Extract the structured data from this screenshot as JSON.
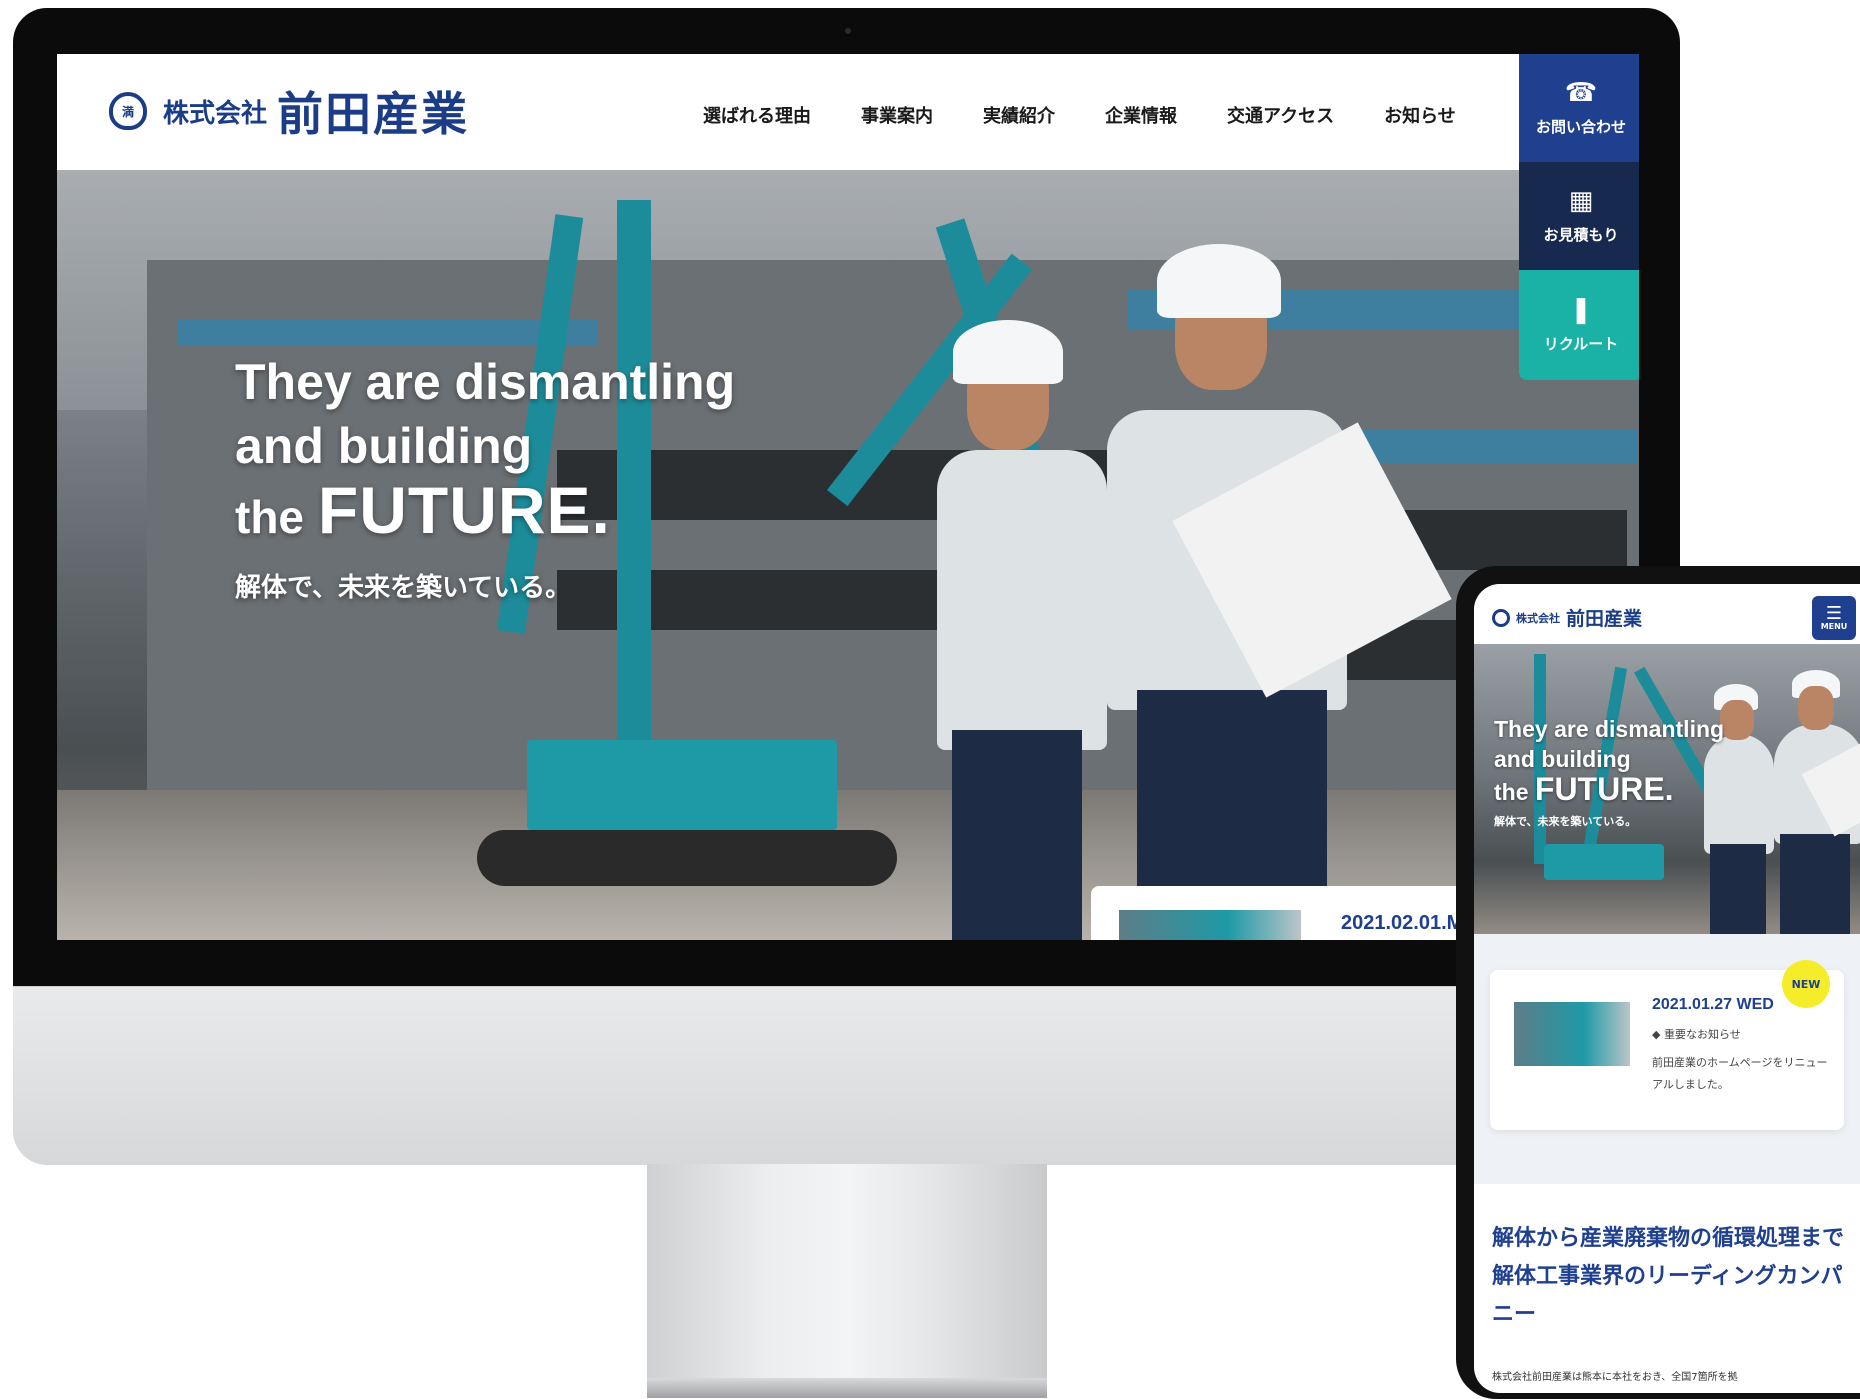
{
  "desktop": {
    "logo": {
      "mark_text": "満",
      "prefix": "株式会社",
      "name": "前田産業"
    },
    "nav": [
      "選ばれる理由",
      "事業案内",
      "実績紹介",
      "企業情報",
      "交通アクセス",
      "お知らせ"
    ],
    "side_cta": {
      "contact": {
        "label": "お問い合わせ",
        "icon": "phone-icon"
      },
      "estimate": {
        "label": "お見積もり",
        "icon": "calculator-icon"
      },
      "recruit": {
        "label": "リクルート",
        "icon": "person-icon"
      }
    },
    "hero": {
      "line1": "They are dismantling",
      "line2": "and building",
      "line3_prefix": "the",
      "line3_main": "FUTURE.",
      "subtitle": "解体で、未来を築いている。"
    },
    "news_date": "2021.02.01.M"
  },
  "mobile": {
    "logo": {
      "prefix": "株式会社",
      "name": "前田産業"
    },
    "menu_label": "MENU",
    "hero": {
      "line1": "They are dismantling",
      "line2": "and building",
      "line3_prefix": "the",
      "line3_main": "FUTURE.",
      "subtitle": "解体で、未来を築いている。"
    },
    "news": {
      "badge": "NEW",
      "date": "2021.01.27 WED",
      "category": "重要なお知らせ",
      "text": "前田産業のホームページをリニューアルしました。"
    },
    "heading": "解体から産業廃棄物の循環処理まで解体工事業界のリーディングカンパニー",
    "body": "株式会社前田産業は熊本に本社をおき、全国7箇所を拠"
  },
  "colors": {
    "brand_navy": "#1f3f8f",
    "dark_navy": "#17294f",
    "teal": "#1ab1a6",
    "badge_yellow": "#f5ed2a"
  }
}
